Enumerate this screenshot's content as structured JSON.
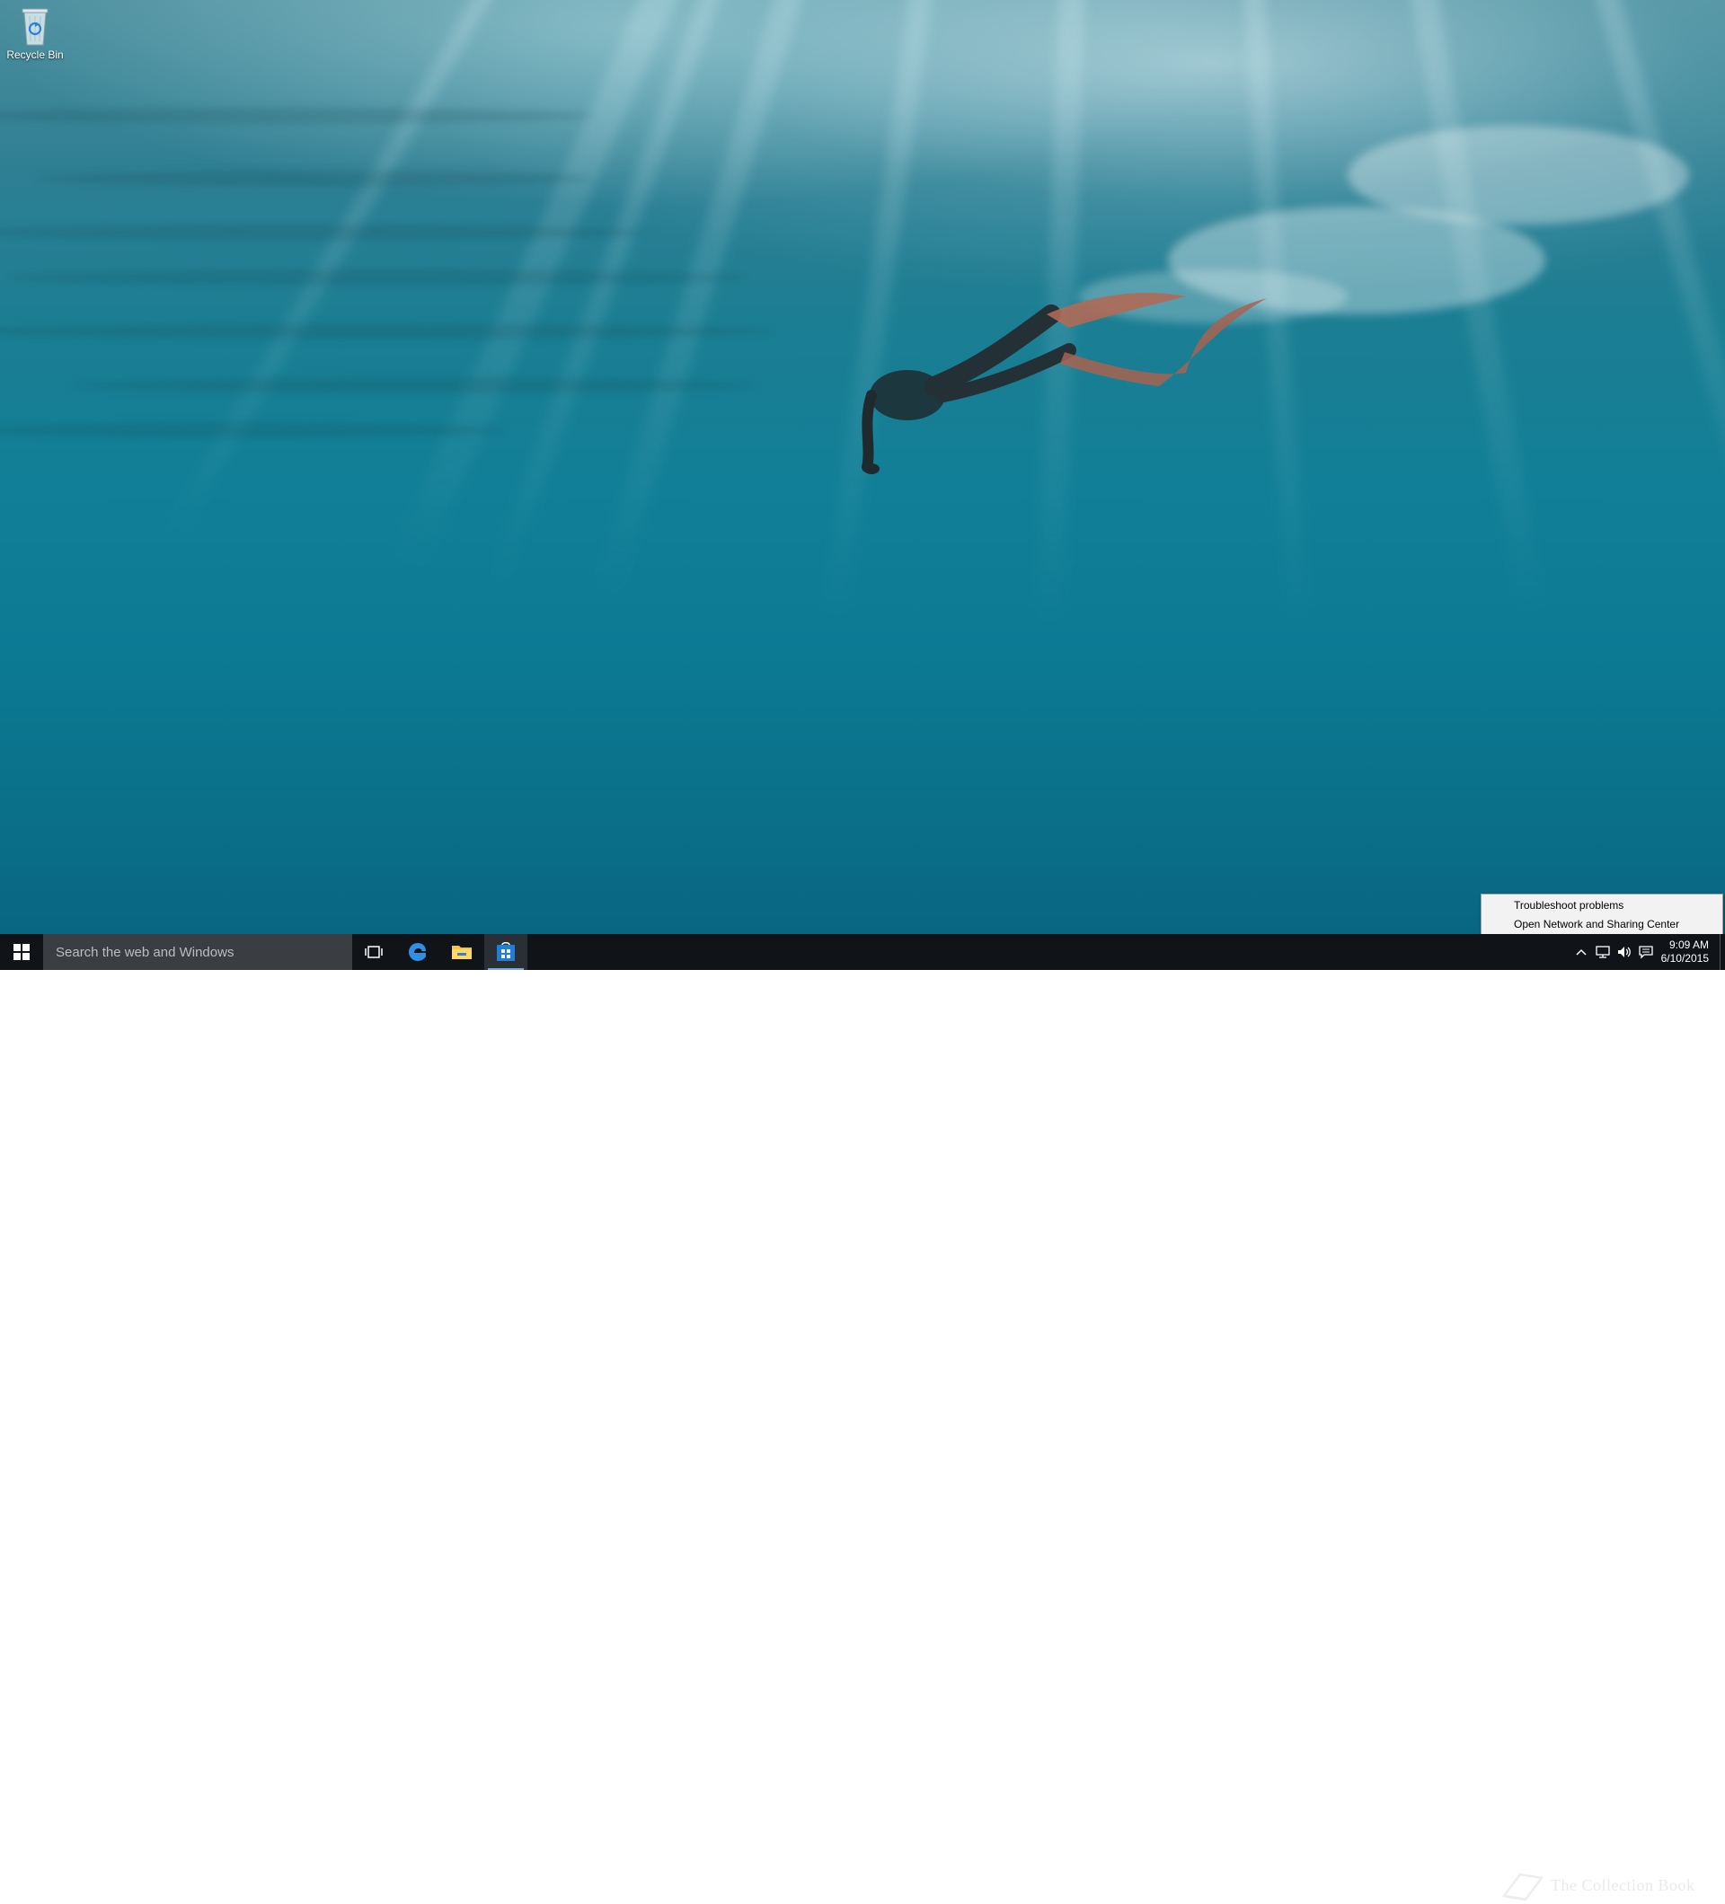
{
  "desktop": {
    "icons": [
      {
        "label": "Recycle Bin",
        "icon": "recycle-bin-icon"
      }
    ]
  },
  "taskbar": {
    "start_icon": "windows-logo-icon",
    "search": {
      "placeholder": "Search the web and Windows",
      "value": ""
    },
    "pinned": [
      {
        "name": "task-view",
        "icon": "task-view-icon"
      },
      {
        "name": "edge",
        "icon": "edge-icon"
      },
      {
        "name": "file-explorer",
        "icon": "folder-icon"
      },
      {
        "name": "store",
        "icon": "store-icon"
      }
    ],
    "watermark": "The Collection Book",
    "tray": {
      "icons": [
        "chevron-up-icon",
        "network-icon",
        "volume-icon",
        "action-center-icon"
      ],
      "time": "9:09 AM",
      "date": "6/10/2015"
    }
  },
  "context_menu": {
    "items": [
      "Troubleshoot problems",
      "Open Network and Sharing Center"
    ]
  },
  "colors": {
    "taskbar": "#101418",
    "search_box": "#3a3d42",
    "accent": "#1e90e8",
    "menu_bg": "#f2f2f2"
  }
}
